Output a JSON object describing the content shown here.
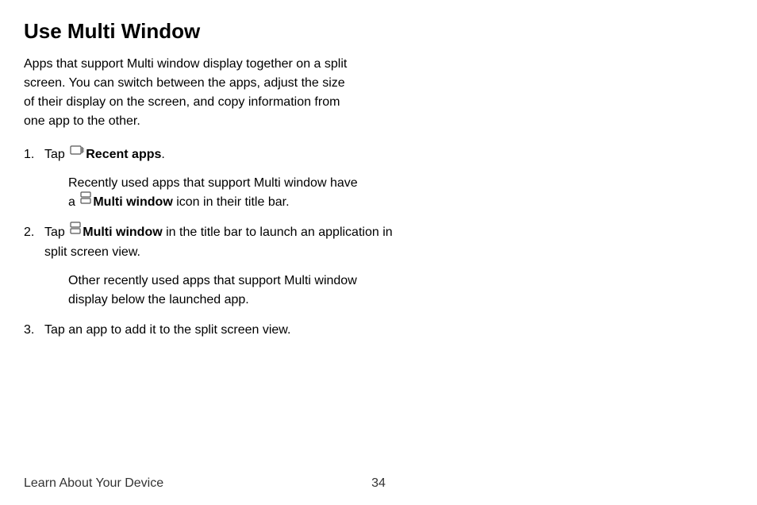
{
  "title": "Use Multi Window",
  "intro": "Apps that support Multi window display together on a split screen. You can switch between the apps, adjust the size of their display on the screen, and copy information from one app to the other.",
  "steps": {
    "s1": {
      "pre": "Tap ",
      "bold": "Recent apps",
      "post": ".",
      "sub_pre": "Recently used apps that support Multi window have a ",
      "sub_bold": "Multi window",
      "sub_post": " icon in their title bar."
    },
    "s2": {
      "pre": "Tap ",
      "bold": "Multi window",
      "post": " in the title bar to launch an application in split screen view.",
      "sub": "Other recently used apps that support Multi window display below the launched app."
    },
    "s3": {
      "text": "Tap an app to add it to the split screen view."
    }
  },
  "footer": {
    "section": "Learn About Your Device",
    "page": "34"
  }
}
